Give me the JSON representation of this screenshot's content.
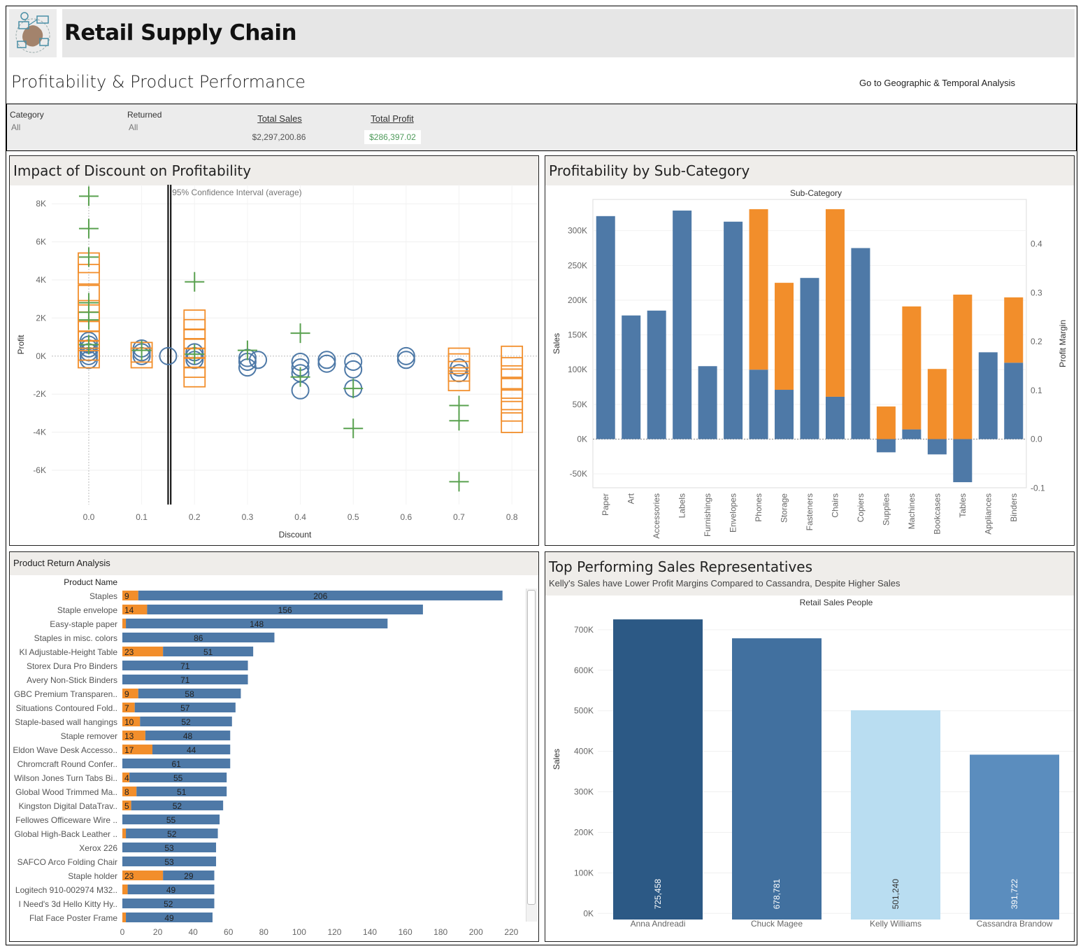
{
  "app": {
    "title": "Retail Supply Chain",
    "subtitle": "Profitability & Product Performance",
    "nav_link": "Go to Geographic & Temporal Analysis"
  },
  "filters": [
    {
      "label": "Category",
      "value": "All"
    },
    {
      "label": "Returned",
      "value": "All"
    }
  ],
  "kpis": [
    {
      "label": "Total Sales",
      "value": "$2,297,200.86",
      "color": "#555555"
    },
    {
      "label": "Total Profit",
      "value": "$286,397.02",
      "color": "#4e9a5a"
    }
  ],
  "colors": {
    "blue": "#4e79a7",
    "orange": "#f28e2b",
    "green": "#59a14f"
  },
  "panels": {
    "discount": {
      "title": "Impact of Discount on Profitability",
      "annotation": "95% Confidence Interval (average)"
    },
    "subcategory": {
      "title": "Profitability by Sub-Category"
    },
    "returns": {
      "title": "Product Return Analysis"
    },
    "reps": {
      "title": "Top Performing Sales Representatives",
      "subtitle": "Kelly's Sales have Lower Profit Margins Compared to Cassandra, Despite Higher Sales"
    }
  },
  "chart_data": [
    {
      "type": "scatter",
      "title": "Impact of Discount on Profitability",
      "xlabel": "Discount",
      "ylabel": "Profit",
      "xlim": [
        -0.07,
        0.85
      ],
      "ylim": [
        -7800,
        9000
      ],
      "xticks": [
        0.0,
        0.1,
        0.2,
        0.3,
        0.4,
        0.5,
        0.6,
        0.7,
        0.8
      ],
      "xtick_labels": [
        "0.0",
        "0.1",
        "0.2",
        "0.3",
        "0.4",
        "0.5",
        "0.6",
        "0.7",
        "0.8"
      ],
      "yticks": [
        8000,
        6000,
        4000,
        2000,
        0,
        -2000,
        -4000,
        -6000
      ],
      "ytick_labels": [
        "8K",
        "6K",
        "4K",
        "2K",
        "0K",
        "-2K",
        "-4K",
        "-6K"
      ],
      "reference_lines": [
        0.15,
        0.155
      ],
      "series": [
        {
          "marker": "circle",
          "color": "#4e79a7",
          "points": [
            [
              0,
              0
            ],
            [
              0,
              200
            ],
            [
              0,
              400
            ],
            [
              0,
              600
            ],
            [
              0,
              -200
            ],
            [
              0,
              800
            ],
            [
              0.1,
              200
            ],
            [
              0.1,
              400
            ],
            [
              0.1,
              0
            ],
            [
              0.15,
              0
            ],
            [
              0.2,
              0
            ],
            [
              0.2,
              200
            ],
            [
              0.2,
              -200
            ],
            [
              0.3,
              -300
            ],
            [
              0.3,
              -100
            ],
            [
              0.3,
              -600
            ],
            [
              0.32,
              -200
            ],
            [
              0.4,
              -300
            ],
            [
              0.4,
              -600
            ],
            [
              0.4,
              -900
            ],
            [
              0.4,
              -1800
            ],
            [
              0.45,
              -200
            ],
            [
              0.45,
              -400
            ],
            [
              0.5,
              -300
            ],
            [
              0.5,
              -700
            ],
            [
              0.5,
              -1700
            ],
            [
              0.6,
              0
            ],
            [
              0.6,
              -200
            ],
            [
              0.7,
              -600
            ],
            [
              0.7,
              -900
            ]
          ]
        },
        {
          "marker": "square",
          "color": "#f28e2b",
          "points": [
            [
              0,
              4900
            ],
            [
              0,
              4300
            ],
            [
              0,
              3200
            ],
            [
              0,
              2400
            ],
            [
              0,
              1800
            ],
            [
              0,
              1300
            ],
            [
              0,
              800
            ],
            [
              0,
              300
            ],
            [
              0,
              -100
            ],
            [
              0.1,
              -100
            ],
            [
              0.1,
              200
            ],
            [
              0.2,
              1900
            ],
            [
              0.2,
              1400
            ],
            [
              0.2,
              900
            ],
            [
              0.2,
              400
            ],
            [
              0.2,
              -100
            ],
            [
              0.2,
              -600
            ],
            [
              0.2,
              -1100
            ],
            [
              0.7,
              -100
            ],
            [
              0.7,
              -400
            ],
            [
              0.7,
              -800
            ],
            [
              0.7,
              -1300
            ],
            [
              0.8,
              0
            ],
            [
              0.8,
              -600
            ],
            [
              0.8,
              -1200
            ],
            [
              0.8,
              -1700
            ],
            [
              0.8,
              -2300
            ],
            [
              0.8,
              -2900
            ],
            [
              0.8,
              -3500
            ]
          ]
        },
        {
          "marker": "plus",
          "color": "#59a14f",
          "points": [
            [
              0,
              8400
            ],
            [
              0,
              6700
            ],
            [
              0,
              5200
            ],
            [
              0,
              2800
            ],
            [
              0,
              2300
            ],
            [
              0,
              1900
            ],
            [
              0,
              600
            ],
            [
              0.1,
              300
            ],
            [
              0.2,
              3900
            ],
            [
              0.2,
              100
            ],
            [
              0.3,
              300
            ],
            [
              0.4,
              1200
            ],
            [
              0.4,
              -1100
            ],
            [
              0.5,
              -1700
            ],
            [
              0.5,
              -3800
            ],
            [
              0.7,
              -2600
            ],
            [
              0.7,
              -3400
            ],
            [
              0.7,
              -6600
            ]
          ]
        }
      ]
    },
    {
      "type": "bar",
      "title": "Sub-Category",
      "xlabel": "",
      "ylabel": "Sales",
      "ylabel2": "Profit Margin",
      "ylim": [
        -70000,
        345000
      ],
      "yticks": [
        300000,
        250000,
        200000,
        150000,
        100000,
        50000,
        0,
        -50000
      ],
      "ytick_labels": [
        "300K",
        "250K",
        "200K",
        "150K",
        "100K",
        "50K",
        "0K",
        "-50K"
      ],
      "y2ticks": [
        0.4,
        0.3,
        0.2,
        0.1,
        0.0,
        -0.1
      ],
      "y2tick_labels": [
        "0.4",
        "0.3",
        "0.2",
        "0.1",
        "0.0",
        "-0.1"
      ],
      "categories": [
        "Paper",
        "Art",
        "Accessories",
        "Labels",
        "Furnishings",
        "Envelopes",
        "Phones",
        "Storage",
        "Fasteners",
        "Chairs",
        "Copiers",
        "Supplies",
        "Machines",
        "Bookcases",
        "Tables",
        "Appliances",
        "Binders"
      ],
      "series": [
        {
          "color": "#4e79a7",
          "values": [
            321000,
            178000,
            185000,
            329000,
            105000,
            313000,
            100000,
            71000,
            232000,
            61000,
            275000,
            -19000,
            14000,
            -22000,
            -62000,
            125000,
            110000
          ]
        },
        {
          "color": "#f28e2b",
          "values": [
            0,
            0,
            0,
            0,
            0,
            0,
            231000,
            154000,
            0,
            270000,
            0,
            47000,
            177000,
            101000,
            208000,
            0,
            94000
          ]
        }
      ]
    },
    {
      "type": "bar",
      "title": "Product Return Analysis",
      "orientation": "horizontal",
      "category_header": "Product Name",
      "xlim": [
        0,
        225
      ],
      "xticks": [
        0,
        20,
        40,
        60,
        80,
        100,
        120,
        140,
        160,
        180,
        200,
        220
      ],
      "xtick_labels": [
        "0",
        "20",
        "40",
        "60",
        "80",
        "100",
        "120",
        "140",
        "160",
        "180",
        "200",
        "220"
      ],
      "categories": [
        "Staples",
        "Staple envelope",
        "Easy-staple paper",
        "Staples in misc. colors",
        "KI Adjustable-Height Table",
        "Storex Dura Pro Binders",
        "Avery Non-Stick Binders",
        "GBC Premium Transparen..",
        "Situations Contoured Fold..",
        "Staple-based wall hangings",
        "Staple remover",
        "Eldon Wave Desk Accesso..",
        "Chromcraft Round Confer..",
        "Wilson Jones Turn Tabs Bi..",
        "Global Wood Trimmed Ma..",
        "Kingston Digital DataTrav..",
        "Fellowes Officeware Wire ..",
        "Global High-Back Leather ..",
        "Xerox 226",
        "SAFCO Arco Folding Chair",
        "Staple holder",
        "Logitech 910-002974 M32..",
        "I Need's 3d Hello Kitty Hy..",
        "Flat Face Poster Frame"
      ],
      "series": [
        {
          "name": "",
          "color": "#f28e2b",
          "values": [
            9,
            14,
            2,
            0,
            23,
            0,
            0,
            9,
            7,
            10,
            13,
            17,
            0,
            4,
            8,
            5,
            0,
            2,
            0,
            0,
            23,
            3,
            0,
            2
          ],
          "labels": [
            "9",
            "14",
            "",
            "",
            "23",
            "",
            "",
            "9",
            "7",
            "10",
            "13",
            "17",
            "",
            "4",
            "8",
            "5",
            "",
            "",
            "",
            "",
            "23",
            "",
            "",
            ""
          ]
        },
        {
          "name": "",
          "color": "#4e79a7",
          "values": [
            206,
            156,
            148,
            86,
            51,
            71,
            71,
            58,
            57,
            52,
            48,
            44,
            61,
            55,
            51,
            52,
            55,
            52,
            53,
            53,
            29,
            49,
            52,
            49
          ],
          "labels": [
            "206",
            "156",
            "148",
            "86",
            "51",
            "71",
            "71",
            "58",
            "57",
            "52",
            "48",
            "44",
            "61",
            "55",
            "51",
            "52",
            "55",
            "52",
            "53",
            "53",
            "29",
            "49",
            "52",
            "49"
          ]
        }
      ]
    },
    {
      "type": "bar",
      "title": "Retail Sales People",
      "xlabel": "",
      "ylabel": "Sales",
      "ylim": [
        -15000,
        755000
      ],
      "yticks": [
        700000,
        600000,
        500000,
        400000,
        300000,
        200000,
        100000,
        0
      ],
      "ytick_labels": [
        "700K",
        "600K",
        "500K",
        "400K",
        "300K",
        "200K",
        "100K",
        "0K"
      ],
      "categories": [
        "Anna Andreadi",
        "Chuck Magee",
        "Kelly Williams",
        "Cassandra Brandow"
      ],
      "values": [
        725458,
        678781,
        501240,
        391722
      ],
      "value_labels": [
        "725,458",
        "678,781",
        "501,240",
        "391,722"
      ],
      "colors": [
        "#2c5985",
        "#41709f",
        "#b9ddf1",
        "#5b8dbe"
      ]
    }
  ]
}
